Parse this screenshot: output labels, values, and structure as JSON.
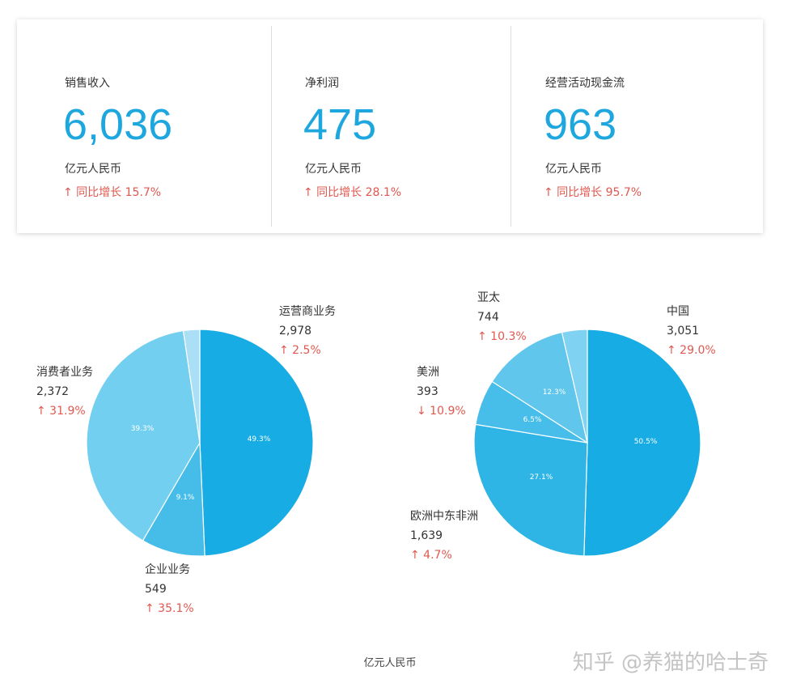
{
  "kpis": [
    {
      "title": "销售收入",
      "value": "6,036",
      "unit": "亿元人民币",
      "growth": "↑ 同比增长 15.7%"
    },
    {
      "title": "净利润",
      "value": "475",
      "unit": "亿元人民币",
      "growth": "↑ 同比增长 28.1%"
    },
    {
      "title": "经营活动现金流",
      "value": "963",
      "unit": "亿元人民币",
      "growth": "↑ 同比增长 95.7%"
    }
  ],
  "footer_unit": "亿元人民币",
  "watermark": "知乎 @养猫的哈士奇",
  "colors": {
    "accent": "#1ea6de",
    "growth_up": "#e0584f"
  },
  "chart_data": [
    {
      "type": "pie",
      "slices": [
        {
          "name": "运营商业务",
          "value": 2978,
          "value_label": "2,978",
          "percent_label": "49.3%",
          "change": "↑ 2.5%",
          "color": "#17ace3"
        },
        {
          "name": "企业业务",
          "value": 549,
          "value_label": "549",
          "percent_label": "9.1%",
          "change": "↑ 35.1%",
          "color": "#45bde8"
        },
        {
          "name": "消费者业务",
          "value": 2372,
          "value_label": "2,372",
          "percent_label": "39.3%",
          "change": "↑ 31.9%",
          "color": "#73cff0"
        },
        {
          "name": "",
          "value": 141,
          "value_label": "",
          "percent_label": "",
          "change": "",
          "color": "#aadff5"
        }
      ]
    },
    {
      "type": "pie",
      "slices": [
        {
          "name": "中国",
          "value": 3051,
          "value_label": "3,051",
          "percent_label": "50.5%",
          "change": "↑ 29.0%",
          "color": "#17ace3"
        },
        {
          "name": "欧洲中东非洲",
          "value": 1639,
          "value_label": "1,639",
          "percent_label": "27.1%",
          "change": "↑ 4.7%",
          "color": "#2fb4e6"
        },
        {
          "name": "美洲",
          "value": 393,
          "value_label": "393",
          "percent_label": "6.5%",
          "change": "↓ 10.9%",
          "color": "#47bde9"
        },
        {
          "name": "亚太",
          "value": 744,
          "value_label": "744",
          "percent_label": "12.3%",
          "change": "↑ 10.3%",
          "color": "#60c6ec"
        },
        {
          "name": "",
          "value": 218,
          "value_label": "",
          "percent_label": "",
          "change": "",
          "color": "#80d2f2"
        }
      ]
    }
  ]
}
